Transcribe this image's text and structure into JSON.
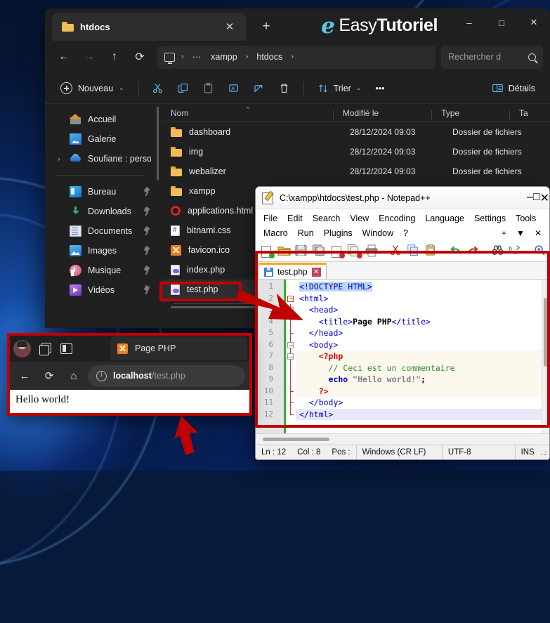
{
  "explorer": {
    "tab": {
      "label": "htdocs",
      "folder_icon": "folder-icon",
      "close_icon": "close-icon"
    },
    "new_tab_icon": "plus-icon",
    "watermark": {
      "mark": "e",
      "light": "Easy",
      "bold": "Tutoriel"
    },
    "window_controls": {
      "minimize": "–",
      "maximize": "□",
      "close": "✕"
    },
    "nav": {
      "back": "←",
      "forward": "→",
      "up": "↑",
      "refresh": "⟳"
    },
    "breadcrumb": {
      "root_icon": "monitor-icon",
      "sep": "›",
      "overflow": "···",
      "items": [
        "xampp",
        "htdocs"
      ]
    },
    "search": {
      "placeholder": "Rechercher d",
      "icon": "search-icon"
    },
    "toolbar": {
      "new_label": "Nouveau",
      "new_caret": "⌄",
      "cut": "cut-icon",
      "copy": "copy-icon",
      "paste": "paste-icon",
      "rename": "rename-icon",
      "share": "share-icon",
      "delete": "delete-icon",
      "sort_label": "Trier",
      "sort_caret": "⌄",
      "more": "•••",
      "details_label": "Détails"
    },
    "sidebar": {
      "items": [
        {
          "label": "Accueil",
          "icon": "home-icon",
          "caret": "",
          "pinned": false
        },
        {
          "label": "Galerie",
          "icon": "gallery-icon",
          "caret": "",
          "pinned": false
        },
        {
          "label": "Soufiane : perso",
          "icon": "onedrive-icon",
          "caret": "›",
          "pinned": false
        }
      ],
      "pinned_items": [
        {
          "label": "Bureau",
          "icon": "desktop-icon",
          "pinned": true
        },
        {
          "label": "Downloads",
          "icon": "downloads-icon",
          "pinned": true
        },
        {
          "label": "Documents",
          "icon": "documents-icon",
          "pinned": true
        },
        {
          "label": "Images",
          "icon": "images-icon",
          "pinned": true
        },
        {
          "label": "Musique",
          "icon": "music-icon",
          "pinned": true
        },
        {
          "label": "Vidéos",
          "icon": "videos-icon",
          "pinned": true
        }
      ]
    },
    "list": {
      "columns": [
        "Nom",
        "Modifié le",
        "Type",
        "Ta"
      ],
      "sort_indicator": "⌃",
      "rows": [
        {
          "name": "dashboard",
          "icon": "folder-icon",
          "modified": "28/12/2024 09:03",
          "type": "Dossier de fichiers"
        },
        {
          "name": "img",
          "icon": "folder-icon",
          "modified": "28/12/2024 09:03",
          "type": "Dossier de fichiers"
        },
        {
          "name": "webalizer",
          "icon": "folder-icon",
          "modified": "28/12/2024 09:03",
          "type": "Dossier de fichiers"
        },
        {
          "name": "xampp",
          "icon": "folder-icon",
          "modified": "",
          "type": ""
        },
        {
          "name": "applications.html",
          "icon": "opera-icon",
          "modified": "",
          "type": ""
        },
        {
          "name": "bitnami.css",
          "icon": "css-icon",
          "modified": "",
          "type": ""
        },
        {
          "name": "favicon.ico",
          "icon": "xampp-icon",
          "modified": "",
          "type": ""
        },
        {
          "name": "index.php",
          "icon": "php-icon",
          "modified": "",
          "type": ""
        },
        {
          "name": "test.php",
          "icon": "php-icon",
          "modified": "",
          "type": ""
        }
      ]
    }
  },
  "notepad": {
    "title": "C:\\xampp\\htdocs\\test.php - Notepad++",
    "app_icon": "notepad-plus-plus-icon",
    "window_controls": {
      "minimize": "–",
      "maximize": "□",
      "close": "✕"
    },
    "menu_row1": [
      "File",
      "Edit",
      "Search",
      "View",
      "Encoding",
      "Language",
      "Settings",
      "Tools"
    ],
    "menu_row2": [
      "Macro",
      "Run",
      "Plugins",
      "Window",
      "?"
    ],
    "menu_right": [
      "+",
      "▼",
      "✕"
    ],
    "toolbar_overflow": "»",
    "tab": {
      "label": "test.php",
      "save_icon": "save-icon",
      "close_icon": "close-icon"
    },
    "code_lines": [
      {
        "n": 1,
        "indent": 0
      },
      {
        "n": 2,
        "indent": 0
      },
      {
        "n": 3,
        "indent": 0
      },
      {
        "n": 4,
        "indent": 0
      },
      {
        "n": 5,
        "indent": 0
      },
      {
        "n": 6,
        "indent": 0
      },
      {
        "n": 7,
        "indent": 0
      },
      {
        "n": 8,
        "indent": 0
      },
      {
        "n": 9,
        "indent": 0
      },
      {
        "n": 10,
        "indent": 0
      },
      {
        "n": 11,
        "indent": 0
      },
      {
        "n": 12,
        "indent": 0
      }
    ],
    "code_text": {
      "l1": "<!DOCTYPE HTML>",
      "l2": "<html>",
      "l3": "  <head>",
      "l4": "    <title>Page PHP</title>",
      "l5": "  </head>",
      "l6": "  <body>",
      "l7": "    <?php",
      "l8": "      // Ceci est un commentaire",
      "l9": "      echo \"Hello world!\";",
      "l10": "    ?>",
      "l11": "  </body>",
      "l12": "</html>"
    },
    "status": {
      "ln": "Ln : 12",
      "col": "Col : 8",
      "pos": "Pos :",
      "eol": "Windows (CR LF)",
      "encoding": "UTF-8",
      "mode": "INS"
    }
  },
  "browser": {
    "avatar": "avatar",
    "tab_stack_icon": "tab-stack-icon",
    "split_panel_icon": "split-panel-icon",
    "tab": {
      "label": "Page PHP",
      "favicon": "xampp-favicon"
    },
    "nav": {
      "back": "←",
      "refresh": "⟳",
      "home": "⌂"
    },
    "url": {
      "host": "localhost",
      "path": "/test.php",
      "info_icon": "site-info-icon"
    },
    "page_text": "Hello world!"
  },
  "annotations": {
    "highlight_color": "#c00000",
    "boxes": [
      "test-php-file",
      "notepad-editor",
      "browser-window"
    ],
    "arrows": [
      "file-to-editor-arrow",
      "browser-callout-arrow"
    ]
  }
}
